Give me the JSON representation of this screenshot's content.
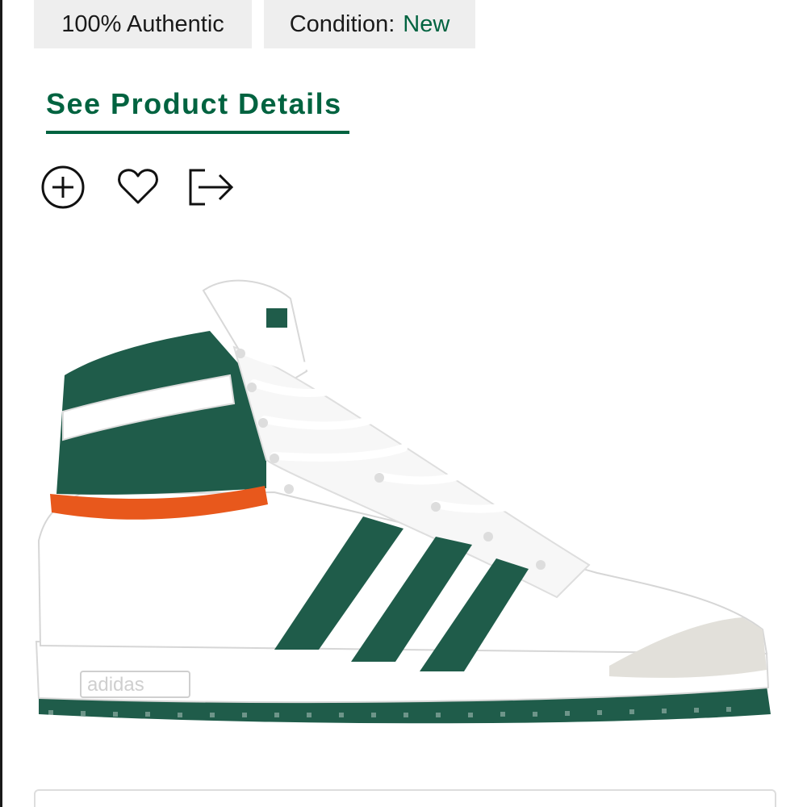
{
  "badges": {
    "authentic": "100% Authentic",
    "condition_label": "Condition:",
    "condition_value": "New"
  },
  "details_link": "See Product Details",
  "actions": [
    {
      "icon": "plus-circle-icon"
    },
    {
      "icon": "heart-icon"
    },
    {
      "icon": "share-icon"
    }
  ],
  "product": {
    "brand_mark": "adidas",
    "colors": {
      "primary": "#ffffff",
      "accent_green": "#1f5c4a",
      "accent_orange": "#e8581c",
      "suede": "#e2e0da"
    }
  },
  "theme": {
    "brand_green": "#006340",
    "badge_bg": "#eeeeee"
  }
}
